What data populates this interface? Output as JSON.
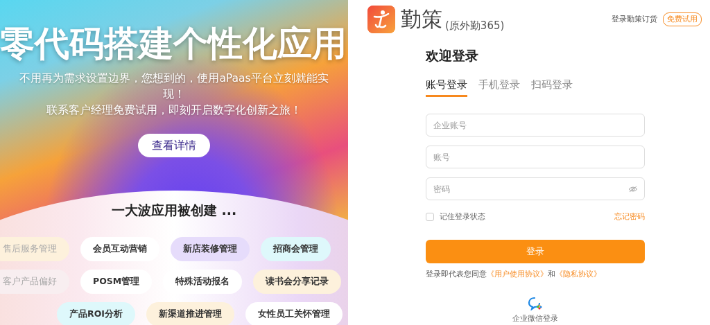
{
  "banner": {
    "headline": "零代码搭建个性化应用",
    "subtitle_lines": [
      "不用再为需求设置边界，您想到的，使用aPaas平台立刻就能实现！",
      "联系客户经理免费试用，即刻开启数字化创新之旅！"
    ],
    "details_button": "查看详情",
    "showcase_title": "一大波应用被创建 ...",
    "chip_rows": [
      [
        {
          "label": "售后服务管理",
          "color": "#fdf1dc",
          "faded": true
        },
        {
          "label": "会员互动营销",
          "color": "#ffffff",
          "faded": false
        },
        {
          "label": "新店装修管理",
          "color": "#e6dcfb",
          "faded": false
        },
        {
          "label": "招商会管理",
          "color": "#def8fb",
          "faded": false
        }
      ],
      [
        {
          "label": "客户产品偏好",
          "color": "#f8eef0",
          "faded": true
        },
        {
          "label": "POSM管理",
          "color": "#ffffff",
          "faded": false
        },
        {
          "label": "特殊活动报名",
          "color": "#ffffff",
          "faded": false
        },
        {
          "label": "读书会分享记录",
          "color": "#fdf1dc",
          "faded": false
        }
      ],
      [
        {
          "label": "产品ROI分析",
          "color": "#def8fb",
          "faded": false
        },
        {
          "label": "新渠道推进管理",
          "color": "#fdf1dc",
          "faded": false
        },
        {
          "label": "女性员工关怀管理",
          "color": "#ffffff",
          "faded": false
        }
      ]
    ]
  },
  "header": {
    "brand": "勤策",
    "brand_note": "(原外勤365)",
    "order_link": "登录勤策订货",
    "trial_button": "免费试用"
  },
  "login": {
    "title": "欢迎登录",
    "tabs": [
      {
        "label": "账号登录",
        "selected": true
      },
      {
        "label": "手机登录",
        "selected": false
      },
      {
        "label": "扫码登录",
        "selected": false
      }
    ],
    "fields": [
      {
        "placeholder": "企业账号",
        "kind": "text"
      },
      {
        "placeholder": "账号",
        "kind": "text"
      },
      {
        "placeholder": "密码",
        "kind": "password"
      }
    ],
    "remember": {
      "label": "记住登录状态",
      "checked": false
    },
    "forgot_link": "忘记密码",
    "submit_button": "登录",
    "agreement": {
      "text": "登录即代表您同意",
      "link_1": "《用户使用协议》",
      "joiner": "和",
      "link_2": "《隐私协议》"
    },
    "wechat_login": "企业微信登录"
  }
}
